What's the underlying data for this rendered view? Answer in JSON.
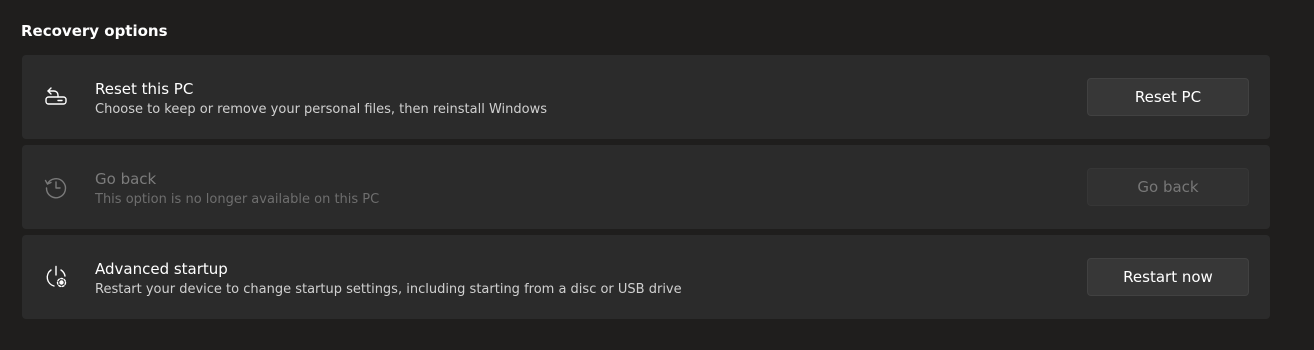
{
  "section": {
    "title": "Recovery options"
  },
  "items": [
    {
      "icon": "reset-pc-icon",
      "title": "Reset this PC",
      "description": "Choose to keep or remove your personal files, then reinstall Windows",
      "button_label": "Reset PC",
      "enabled": true
    },
    {
      "icon": "history-icon",
      "title": "Go back",
      "description": "This option is no longer available on this PC",
      "button_label": "Go back",
      "enabled": false
    },
    {
      "icon": "advanced-startup-icon",
      "title": "Advanced startup",
      "description": "Restart your device to change startup settings, including starting from a disc or USB drive",
      "button_label": "Restart now",
      "enabled": true
    }
  ],
  "colors": {
    "background": "#1f1e1d",
    "card": "#2b2b2b",
    "button": "#373737",
    "text_primary": "#ffffff",
    "text_disabled": "#7c7c7c"
  }
}
